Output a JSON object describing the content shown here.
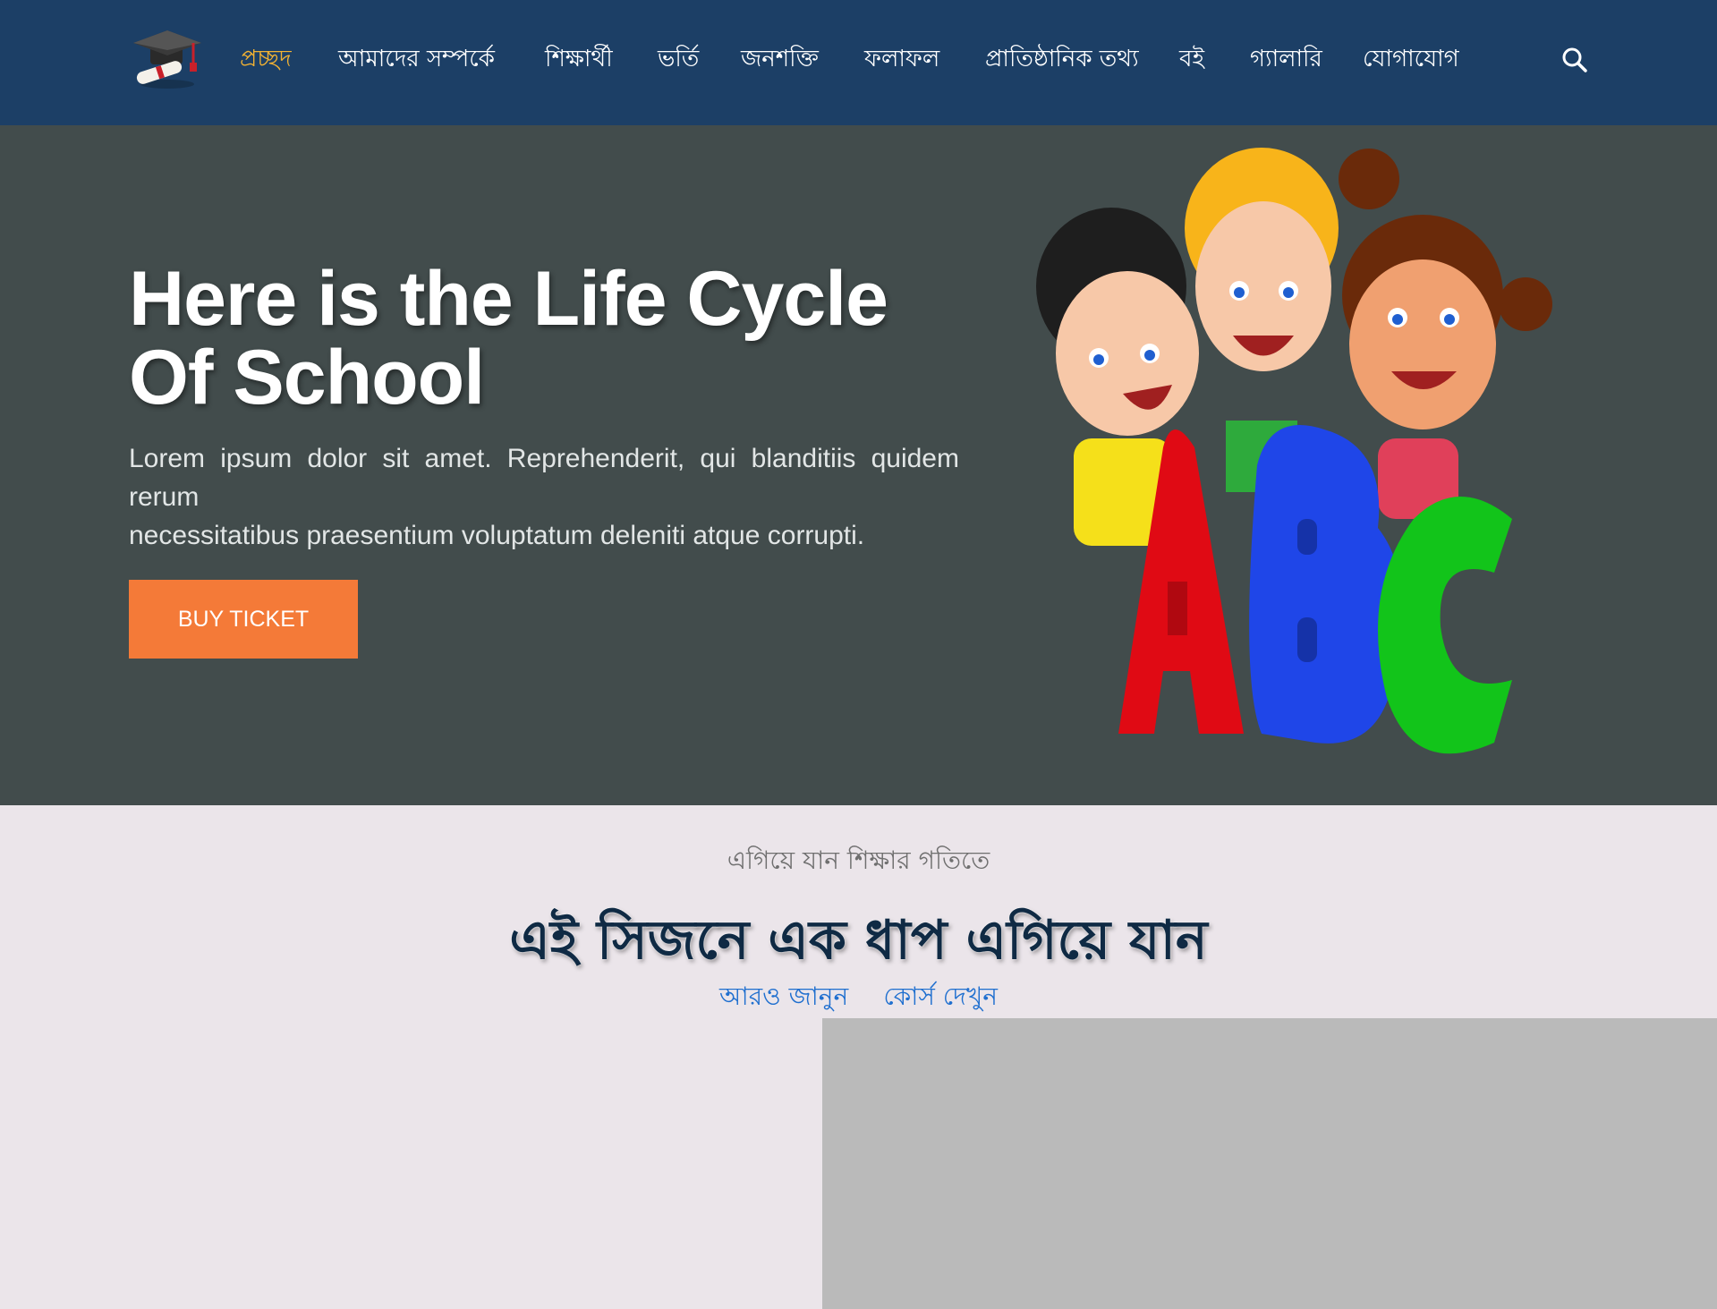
{
  "nav": {
    "logo_icon": "graduation-cap-icon",
    "items": [
      {
        "label": "প্রচ্ছদ",
        "active": true
      },
      {
        "label": "আমাদের সম্পর্কে"
      },
      {
        "label": "শিক্ষার্থী"
      },
      {
        "label": "ভর্তি"
      },
      {
        "label": "জনশক্তি"
      },
      {
        "label": "ফলাফল"
      },
      {
        "label": "প্রাতিষ্ঠানিক তথ্য"
      },
      {
        "label": "বই"
      },
      {
        "label": "গ্যালারি"
      },
      {
        "label": "যোগাযোগ"
      }
    ],
    "search_icon": "search-icon"
  },
  "hero": {
    "title": "Here is the Life Cycle Of School",
    "text_line1": "Lorem ipsum dolor sit amet. Reprehenderit, qui blanditiis quidem rerum",
    "text_line2": "necessitatibus praesentium voluptatum deleniti atque corrupti.",
    "button_label": "BUY TICKET",
    "image": "kids-abc-illustration"
  },
  "promo": {
    "subtitle": "এগিয়ে যান শিক্ষার গতিতে",
    "title": "এই সিজনে এক ধাপ এগিয়ে যান",
    "link_learn_more": "আরও জানুন",
    "link_view_courses": "কোর্স দেখুন"
  },
  "colors": {
    "navbar": "#1c3f66",
    "active_nav": "#f2b233",
    "hero_bg": "#424c4c",
    "button": "#f47a38",
    "link": "#1f6fcf",
    "section_bg": "#ebe5ea"
  }
}
